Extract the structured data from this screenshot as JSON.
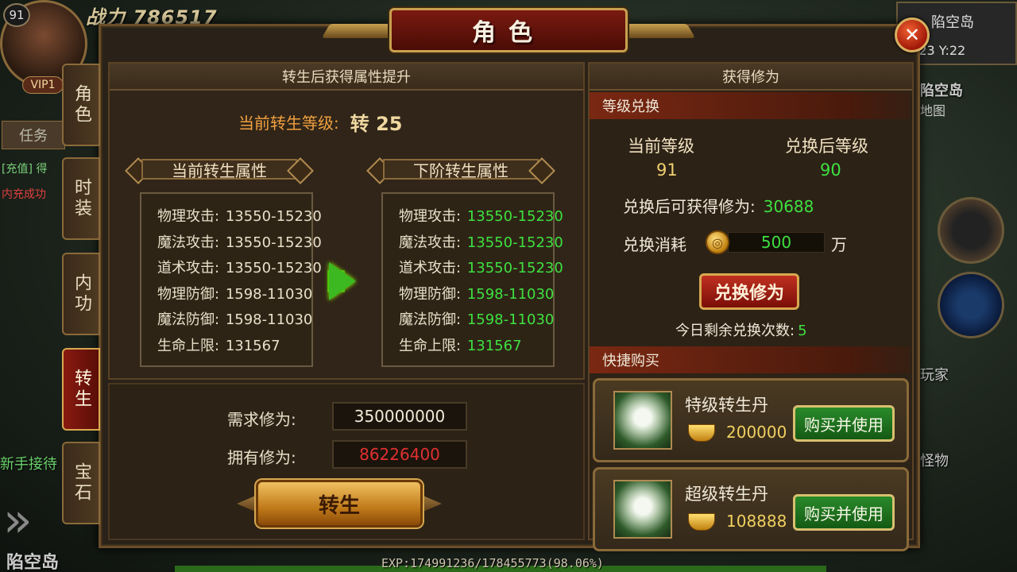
{
  "hud": {
    "level": "91",
    "vip": "VIP1",
    "power_text": "战力 786517",
    "task_tab": "任务",
    "chat_line1": "[充值] 得",
    "chat_line2": "内充成功",
    "newbie": "新手接待",
    "map_name": "陷空岛",
    "coords": "X:23 Y:22",
    "map_name_right": "陷空岛",
    "big_map": "地图",
    "player_label": "玩家",
    "monster_label": "怪物",
    "map_name_bottom": "陷空岛",
    "exp_text": "EXP:174991236/178455773(98.06%)"
  },
  "window": {
    "title": "角色",
    "close_glyph": "✕"
  },
  "tabs": [
    {
      "label": "角色",
      "active": false
    },
    {
      "label": "时装",
      "active": false
    },
    {
      "label": "内功",
      "active": false
    },
    {
      "label": "转生",
      "active": true
    },
    {
      "label": "宝石",
      "active": false
    }
  ],
  "left": {
    "header": "转生后获得属性提升",
    "current_level_label": "当前转生等级:",
    "current_level_value": "转 25",
    "current_attr_title": "当前转生属性",
    "next_attr_title": "下阶转生属性",
    "current_attrs": [
      {
        "name": "物理攻击:",
        "value": "13550-15230"
      },
      {
        "name": "魔法攻击:",
        "value": "13550-15230"
      },
      {
        "name": "道术攻击:",
        "value": "13550-15230"
      },
      {
        "name": "物理防御:",
        "value": "1598-11030"
      },
      {
        "name": "魔法防御:",
        "value": "1598-11030"
      },
      {
        "name": "生命上限:",
        "value": "131567"
      }
    ],
    "next_attrs": [
      {
        "name": "物理攻击:",
        "value": "13550-15230"
      },
      {
        "name": "魔法攻击:",
        "value": "13550-15230"
      },
      {
        "name": "道术攻击:",
        "value": "13550-15230"
      },
      {
        "name": "物理防御:",
        "value": "1598-11030"
      },
      {
        "name": "魔法防御:",
        "value": "1598-11030"
      },
      {
        "name": "生命上限:",
        "value": "131567"
      }
    ],
    "required_label": "需求修为:",
    "required_value": "350000000",
    "owned_label": "拥有修为:",
    "owned_value": "86226400",
    "rebirth_button": "转生"
  },
  "right": {
    "header": "获得修为",
    "exchange_section": "等级兑换",
    "current_level_label": "当前等级",
    "current_level_value": "91",
    "after_level_label": "兑换后等级",
    "after_level_value": "90",
    "gain_label": "兑换后可获得修为:",
    "gain_value": "30688",
    "cost_label": "兑换消耗",
    "cost_value": "500",
    "cost_unit": "万",
    "exchange_button": "兑换修为",
    "remaining_label": "今日剩余兑换次数:",
    "remaining_value": "5",
    "shop_section": "快捷购买",
    "shop_items": [
      {
        "name": "特级转生丹",
        "price": "200000",
        "button": "购买并使用"
      },
      {
        "name": "超级转生丹",
        "price": "108888",
        "button": "购买并使用"
      }
    ]
  },
  "colors": {
    "green_value": "#3ee040",
    "red_value": "#e03030",
    "orange_label": "#f0a040",
    "active_tab": "#8a1a10"
  }
}
